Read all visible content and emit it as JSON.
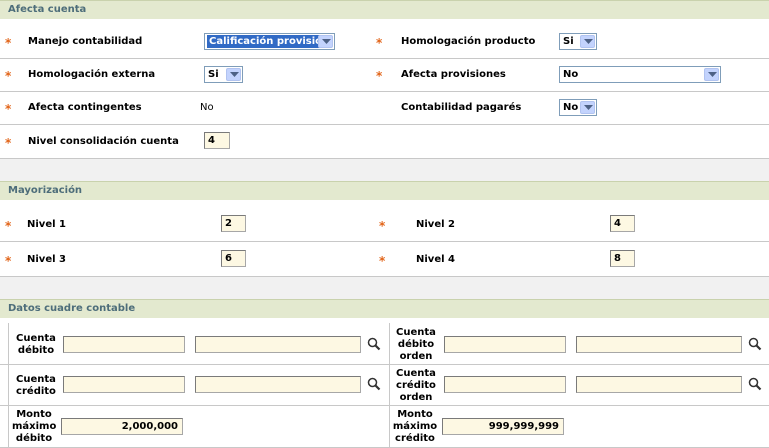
{
  "afecta_cuenta": {
    "title": "Afecta cuenta",
    "manejo_contabilidad": {
      "label": "Manejo contabilidad",
      "value": "Calificación provisión"
    },
    "homologacion_producto": {
      "label": "Homologación producto",
      "value": "Si"
    },
    "homologacion_externa": {
      "label": "Homologación externa",
      "value": "Si"
    },
    "afecta_provisiones": {
      "label": "Afecta provisiones",
      "value": "No"
    },
    "afecta_contingentes": {
      "label": "Afecta contingentes",
      "value": "No"
    },
    "contabilidad_pagares": {
      "label": "Contabilidad pagarés",
      "value": "No"
    },
    "nivel_consolidacion": {
      "label": "Nivel consolidación cuenta",
      "value": "4"
    }
  },
  "mayorizacion": {
    "title": "Mayorización",
    "nivel1": {
      "label": "Nivel 1",
      "value": "2"
    },
    "nivel2": {
      "label": "Nivel 2",
      "value": "4"
    },
    "nivel3": {
      "label": "Nivel 3",
      "value": "6"
    },
    "nivel4": {
      "label": "Nivel 4",
      "value": "8"
    }
  },
  "datos_cuadre": {
    "title": "Datos cuadre contable",
    "cuenta_debito": {
      "label_lines": [
        "Cuenta",
        "débito"
      ],
      "code": "",
      "name": ""
    },
    "cuenta_debito_orden": {
      "label_lines": [
        "Cuenta",
        "débito",
        "orden"
      ],
      "code": "",
      "name": ""
    },
    "cuenta_credito": {
      "label_lines": [
        "Cuenta",
        "crédito"
      ],
      "code": "",
      "name": ""
    },
    "cuenta_credito_orden": {
      "label_lines": [
        "Cuenta",
        "crédito",
        "orden"
      ],
      "code": "",
      "name": ""
    },
    "monto_maximo_debito": {
      "label_lines": [
        "Monto",
        "máximo",
        "débito"
      ],
      "value": "2,000,000"
    },
    "monto_maximo_credito": {
      "label_lines": [
        "Monto",
        "máximo",
        "crédito"
      ],
      "value": "999,999,999"
    }
  },
  "required_marker": "*",
  "icons": {
    "lookup": "magnifier-icon",
    "dropdown": "chevron-down-icon"
  },
  "colors": {
    "section_header_bg": "#e3e9cf",
    "section_header_text": "#4d6d7a",
    "required": "#e2651a",
    "input_bg": "#fdf8e3",
    "selection": "#316ac5"
  }
}
